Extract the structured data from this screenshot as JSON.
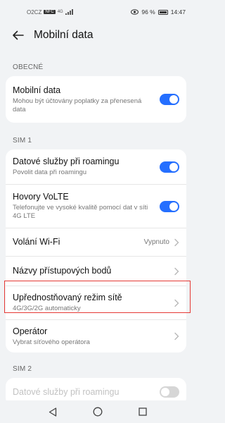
{
  "status_bar": {
    "carrier": "O2CZ",
    "nfc_badge": "NFC",
    "network": "4G",
    "battery_text": "96 %",
    "time": "14:47"
  },
  "header": {
    "title": "Mobilní data"
  },
  "general": {
    "label": "OBECNÉ",
    "mobile_data": {
      "title": "Mobilní data",
      "subtitle": "Mohou být účtovány poplatky za přenesená data",
      "toggle_on": true
    }
  },
  "sim1": {
    "label": "SIM 1",
    "roaming": {
      "title": "Datové služby při roamingu",
      "subtitle": "Povolit data při roamingu",
      "toggle_on": true
    },
    "volte": {
      "title": "Hovory VoLTE",
      "subtitle": "Telefonujte ve vysoké kvalitě pomocí dat v síti 4G LTE",
      "toggle_on": true
    },
    "wifi_calling": {
      "title": "Volání Wi-Fi",
      "value": "Vypnuto"
    },
    "apn": {
      "title": "Názvy přístupových bodů"
    },
    "network_mode": {
      "title": "Upřednostňovaný režim sítě",
      "subtitle": "4G/3G/2G automaticky"
    },
    "operator": {
      "title": "Operátor",
      "subtitle": "Vybrat síťového operátora"
    }
  },
  "sim2": {
    "label": "SIM 2",
    "roaming": {
      "title": "Datové služby při roamingu",
      "toggle_on": false
    }
  },
  "colors": {
    "accent": "#256fff",
    "highlight": "#e53935"
  }
}
